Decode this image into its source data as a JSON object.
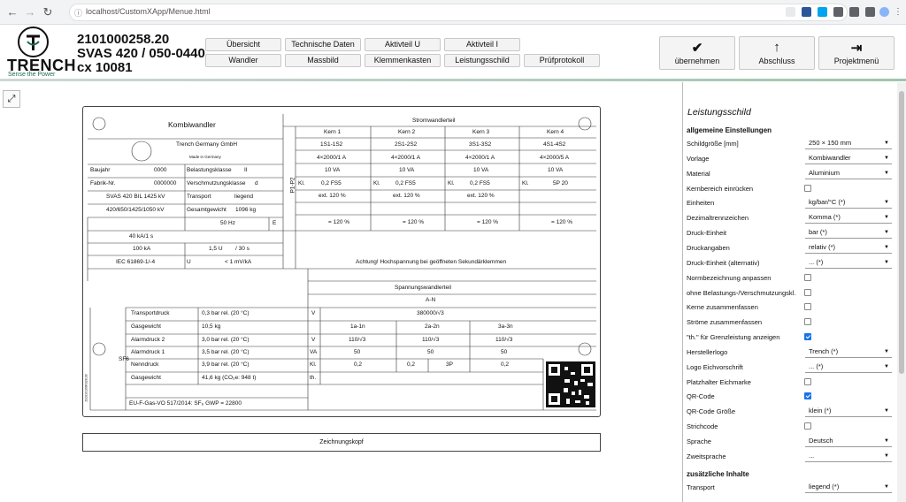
{
  "browser": {
    "url": "localhost/CustomXApp/Menue.html"
  },
  "logo": {
    "name": "TRENCH",
    "slogan": "Sense the Power"
  },
  "header": {
    "order_no": "2101000258.20",
    "type": "SVAS 420 / 050-0440",
    "cx": "cx 10081",
    "tabs_row1": [
      "Übersicht",
      "Technische Daten",
      "Aktivteil U",
      "Aktivteil I"
    ],
    "tabs_row2": [
      "Wandler",
      "Massbild",
      "Klemmenkasten",
      "Leistungsschild",
      "Prüfprotokoll"
    ],
    "actions": [
      {
        "label": "übernehmen",
        "icon": "check-icon"
      },
      {
        "label": "Abschluss",
        "icon": "arrow-up-icon"
      },
      {
        "label": "Projektmenü",
        "icon": "exit-icon"
      }
    ]
  },
  "plate": {
    "title": "Kombiwandler",
    "maker": "Trench Germany GmbH",
    "made_in": "Made in Germany",
    "rows_left": [
      [
        "Baujahr",
        "0000",
        "Belastungsklasse",
        "II"
      ],
      [
        "Fabrik-Nr.",
        "0000000",
        "Verschmutzungsklasse",
        "d"
      ],
      [
        "SVAS 420 BIL 1425 kV",
        "",
        "Transport",
        "liegend"
      ],
      [
        "420/650/1425/1050 kV",
        "",
        "Gesamtgewicht",
        "1096 kg"
      ]
    ],
    "freq": "50 Hz",
    "e_label": "E",
    "ith": "40 kA/1 s",
    "idyn": "100 kA",
    "ith_time": "1,5 U",
    "ith_time2": "/ 30 s",
    "iec": "IEC 61869-1/-4",
    "u_label": "U",
    "ltm": "< 1 mV/kA",
    "warning": "Achtung! Hochspannung bei geöffneten Sekundärklemmen",
    "p1p2": "P1-P2",
    "current_part": "Stromwandlerteil",
    "kerne": [
      "Kern 1",
      "Kern 2",
      "Kern 3",
      "Kern 4"
    ],
    "terminals": [
      "1S1-1S2",
      "2S1-2S2",
      "3S1-3S2",
      "4S1-4S2"
    ],
    "ratios": [
      "4×2000/1 A",
      "4×2000/1 A",
      "4×2000/1 A",
      "4×2000/5 A"
    ],
    "power": [
      "10 VA",
      "10 VA",
      "10 VA",
      "10 VA"
    ],
    "kl_label": "Kl.",
    "classes": [
      "0,2 FS5",
      "0,2 FS5",
      "0,2 FS5",
      "5P 20"
    ],
    "ext": [
      "ext. 120 %",
      "ext. 120 %",
      "ext. 120 %",
      ""
    ],
    "ith_pct": [
      "= 120 %",
      "= 120 %",
      "= 120 %",
      "= 120 %"
    ],
    "voltage_part": "Spannungswandlerteil",
    "an": "A-N",
    "u_ratio": "380000/√3",
    "v_label": "V",
    "windings": [
      "1a-1n",
      "2a-2n",
      "3a-3n"
    ],
    "sec_v": [
      "110/√3",
      "110/√3",
      "110/√3"
    ],
    "va_label": "VA",
    "va": [
      "50",
      "50",
      "50"
    ],
    "v_classes": [
      "0,2",
      "0,2",
      "3P",
      "0,2"
    ],
    "th_label": "th.",
    "sf6_label": "SF6",
    "sf6_rows": [
      [
        "Transportdruck",
        "0,3 bar rel. (20 °C)"
      ],
      [
        "Gasgewicht",
        "10,5 kg"
      ],
      [
        "Alarmdruck 2",
        "3,0 bar rel. (20 °C)"
      ],
      [
        "Alarmdruck 1",
        "3,5 bar rel. (20 °C)"
      ],
      [
        "Nenndruck",
        "3,9 bar rel. (20 °C)"
      ],
      [
        "Gasgewicht",
        "41,6 kg (CO₂e: 948 t)"
      ]
    ],
    "eu": "EU-F-Gas-VO 517/2014: SF₆ GWP = 22800",
    "side_code": "ZL0210106KS28.28"
  },
  "zeichnungskopf": "Zeichnungskopf",
  "panel": {
    "title": "Leistungsschild",
    "section1": "allgemeine Einstellungen",
    "section2": "zusätzliche Inhalte",
    "rows": [
      {
        "label": "Schildgröße [mm]",
        "type": "select",
        "value": "250 × 150 mm"
      },
      {
        "label": "Vorlage",
        "type": "select",
        "value": "Kombiwandler"
      },
      {
        "label": "Material",
        "type": "select",
        "value": "Aluminium"
      },
      {
        "label": "Kernbereich einrücken",
        "type": "check",
        "value": false
      },
      {
        "label": "Einheiten",
        "type": "select",
        "value": "kg/bar/°C (*)"
      },
      {
        "label": "Dezimaltrennzeichen",
        "type": "select",
        "value": "Komma (*)"
      },
      {
        "label": "Druck-Einheit",
        "type": "select",
        "value": "bar (*)"
      },
      {
        "label": "Druckangaben",
        "type": "select",
        "value": "relativ (*)"
      },
      {
        "label": "Druck-Einheit (alternativ)",
        "type": "select",
        "value": "... (*)"
      },
      {
        "label": "Normbezeichnung anpassen",
        "type": "check",
        "value": false
      },
      {
        "label": "ohne Belastungs-/Verschmutzungskl.",
        "type": "check",
        "value": false
      },
      {
        "label": "Kerne zusammenfassen",
        "type": "check",
        "value": false
      },
      {
        "label": "Ströme zusammenfassen",
        "type": "check",
        "value": false
      },
      {
        "label": "\"th.\" für Grenzleistung anzeigen",
        "type": "check",
        "value": true
      },
      {
        "label": "Herstellerlogo",
        "type": "select",
        "value": "Trench (*)"
      },
      {
        "label": "Logo Eichvorschrift",
        "type": "select",
        "value": "... (*)"
      },
      {
        "label": "Platzhalter Eichmarke",
        "type": "check",
        "value": false
      },
      {
        "label": "QR-Code",
        "type": "check",
        "value": true
      },
      {
        "label": "QR-Code Größe",
        "type": "select",
        "value": "klein (*)"
      },
      {
        "label": "Strichcode",
        "type": "check",
        "value": false
      },
      {
        "label": "Sprache",
        "type": "select",
        "value": "Deutsch"
      },
      {
        "label": "Zweitsprache",
        "type": "select",
        "value": "..."
      }
    ],
    "rows2": [
      {
        "label": "Transport",
        "type": "select",
        "value": "liegend (*)"
      }
    ]
  },
  "colors": {
    "accent": "#1b6a57",
    "checkbox": "#1a73e8"
  }
}
